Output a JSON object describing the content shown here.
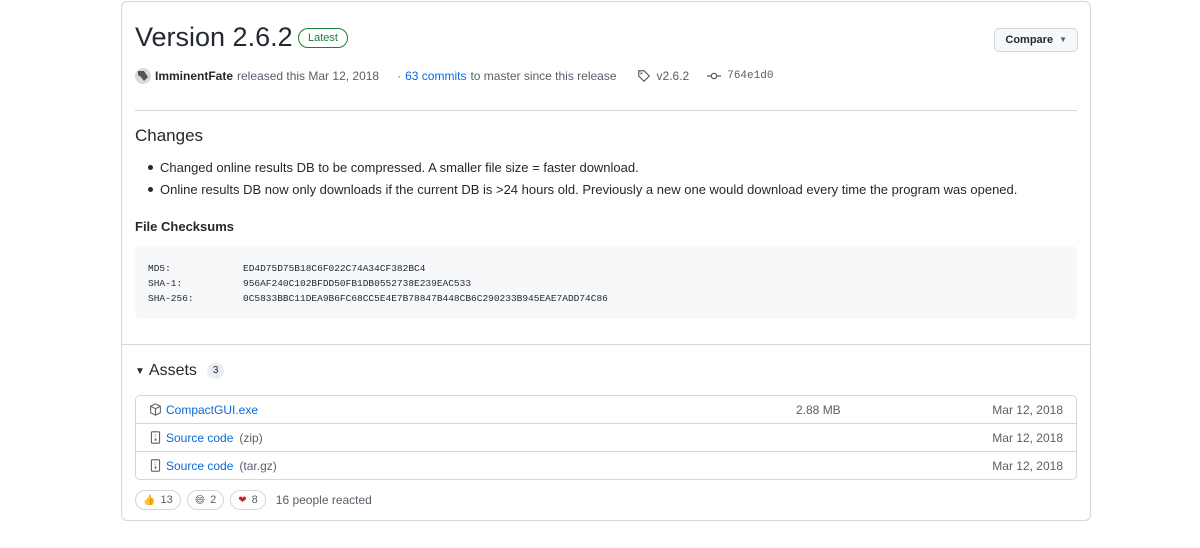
{
  "release": {
    "title": "Version 2.6.2",
    "badge": "Latest",
    "compare_label": "Compare",
    "author": "ImminentFate",
    "released_text": "released this Mar 12, 2018",
    "commits_link": "63 commits",
    "commits_suffix": "to master since this release",
    "commits_prefix": "·",
    "tag": "v2.6.2",
    "commit_sha": "764e1d0"
  },
  "changes": {
    "heading": "Changes",
    "items": [
      "Changed online results DB to be compressed. A smaller file size = faster download.",
      "Online results DB now only downloads if the current DB is >24 hours old. Previously a new one would download every time the program was opened."
    ]
  },
  "checksums": {
    "heading": "File Checksums",
    "rows": [
      {
        "key": "MD5:",
        "value": "ED4D75D75B18C6F022C74A34CF382BC4"
      },
      {
        "key": "SHA-1:",
        "value": "956AF240C102BFDD50FB1DB0552738E239EAC533"
      },
      {
        "key": "SHA-256:",
        "value": "0C5833BBC11DEA9B6FC68CC5E4E7B78847B448CB6C290233B945EAE7ADD74C86"
      }
    ]
  },
  "assets": {
    "heading": "Assets",
    "count": "3",
    "items": [
      {
        "name": "CompactGUI.exe",
        "ext": "",
        "size": "2.88 MB",
        "date": "Mar 12, 2018",
        "icon": "package-icon"
      },
      {
        "name": "Source code",
        "ext": "(zip)",
        "size": "",
        "date": "Mar 12, 2018",
        "icon": "file-zip-icon"
      },
      {
        "name": "Source code",
        "ext": "(tar.gz)",
        "size": "",
        "date": "Mar 12, 2018",
        "icon": "file-zip-icon"
      }
    ]
  },
  "reactions": {
    "thumbs_up": "13",
    "laugh": "2",
    "heart": "8",
    "summary": "16 people reacted"
  },
  "colors": {
    "link": "#0969da",
    "latest_green": "#1a7f37",
    "border": "#d0d7de"
  }
}
